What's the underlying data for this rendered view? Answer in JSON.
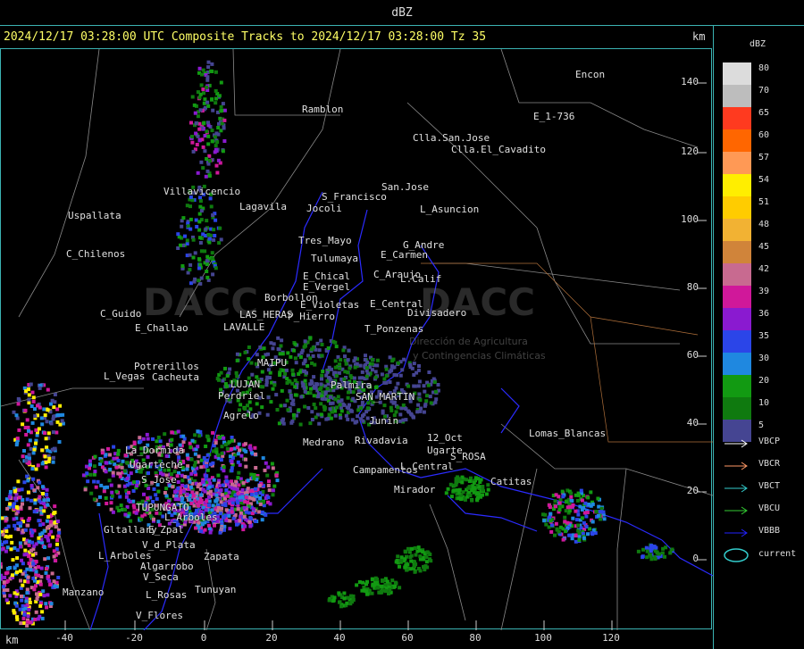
{
  "title": "dBZ",
  "header": "2024/12/17 03:28:00 UTC Composite Tracks to 2024/12/17 03:28:00 Tz 35",
  "km_label": "km",
  "y_ticks": [
    "140",
    "120",
    "100",
    "80",
    "60",
    "40",
    "20",
    "0"
  ],
  "x_ticks": [
    "-40",
    "-20",
    "0",
    "20",
    "40",
    "60",
    "80",
    "100",
    "120"
  ],
  "places": [
    "Encon",
    "E_1-736",
    "Ramblon",
    "Clla.San.Jose",
    "Clla.El_Cavadito",
    "San.Jose",
    "S_Francisco",
    "Jocoli",
    "L_Asuncion",
    "Uspallata",
    "Villavicencio",
    "Lagavila",
    "Tres_Mayo",
    "G_Andre",
    "Tulumaya",
    "E_Carmen",
    "C_Chilenos",
    "E_Chical",
    "E_Vergel",
    "C_Araujo",
    "L.Calif",
    "Borbollon",
    "E_Central",
    "E_Violetas",
    "Divisadero",
    "P_Hierro",
    "C_Guido",
    "E_Challao",
    "LAVALLE",
    "LAS_HERAS",
    "T_Ponzenas",
    "Potrerillos",
    "L_Vegas",
    "Cacheuta",
    "Perdriel",
    "Agrelo",
    "MAIPU",
    "LUJAN",
    "Palmira",
    "SAN_MARTIN",
    "Rivadavia",
    "Medrano",
    "Junin",
    "12_Oct",
    "S_ROSA",
    "Lomas_Blancas",
    "Campamentos",
    "L_Central",
    "Ugarte",
    "Mirador",
    "Catitas",
    "TUPUNGATO",
    "L_Arboles",
    "S_Jose",
    "E_Zpal",
    "V_d_Plata",
    "Zapata",
    "L_Arboles",
    "Algarrobo",
    "V_Seca",
    "Manzano",
    "Tunuyan",
    "L_Rosas",
    "V_Flores",
    "Gltallary",
    "Ugarteche",
    "La_Dormida"
  ],
  "watermark": "DACC",
  "watermark_sub": [
    "Dirección de Agricultura",
    "y Contingencias Climáticas"
  ],
  "legend": {
    "title": "dBZ",
    "levels": [
      {
        "v": "80",
        "c": "#dcdcdc"
      },
      {
        "v": "70",
        "c": "#bdbdbd"
      },
      {
        "v": "65",
        "c": "#ff3a1f"
      },
      {
        "v": "60",
        "c": "#ff6600"
      },
      {
        "v": "57",
        "c": "#ff9955"
      },
      {
        "v": "54",
        "c": "#ffee00"
      },
      {
        "v": "51",
        "c": "#ffcc00"
      },
      {
        "v": "48",
        "c": "#f2b233"
      },
      {
        "v": "45",
        "c": "#d0843a"
      },
      {
        "v": "42",
        "c": "#c86a90"
      },
      {
        "v": "39",
        "c": "#d0189a"
      },
      {
        "v": "36",
        "c": "#8a1ad0"
      },
      {
        "v": "35",
        "c": "#2b45e8"
      },
      {
        "v": "30",
        "c": "#1f88e0"
      },
      {
        "v": "20",
        "c": "#129a12"
      },
      {
        "v": "10",
        "c": "#0f7a0f"
      },
      {
        "v": "5",
        "c": "#454592"
      }
    ],
    "tracks": [
      {
        "name": "VBCP",
        "c": "#ffffff"
      },
      {
        "name": "VBCR",
        "c": "#ff9966"
      },
      {
        "name": "VBCT",
        "c": "#33cccc"
      },
      {
        "name": "VBCU",
        "c": "#33cc33"
      },
      {
        "name": "VBBB",
        "c": "#2222ff"
      }
    ],
    "current": {
      "name": "current",
      "c": "#33cccc"
    }
  }
}
